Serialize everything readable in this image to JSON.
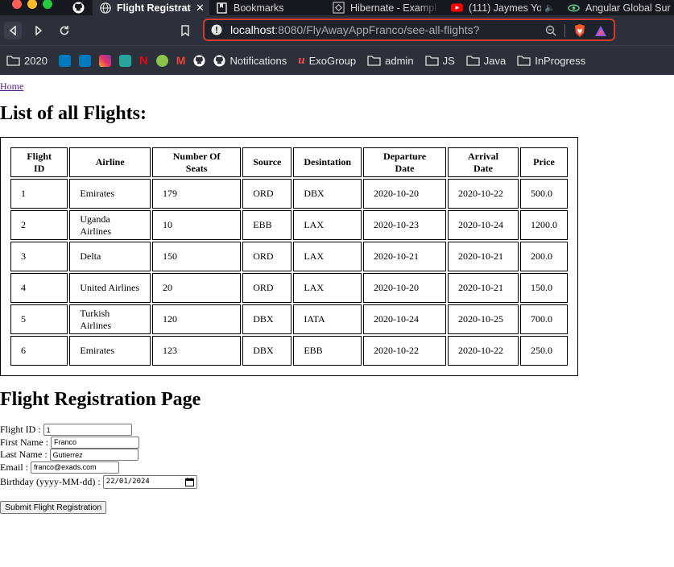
{
  "browser": {
    "tabs": [
      {
        "title": "Flight Registrat"
      },
      {
        "title": "Bookmarks"
      },
      {
        "title": "Hibernate - Exampl"
      },
      {
        "title": "(111) Jaymes Yo"
      },
      {
        "title": "Angular Global Sur"
      }
    ],
    "url": {
      "host": "localhost",
      "rest": ":8080/FlyAwayAppFranco/see-all-flights?"
    },
    "bookmarks": [
      {
        "label": "2020"
      },
      {
        "label": "Notifications"
      },
      {
        "label": "ExoGroup"
      },
      {
        "label": "admin"
      },
      {
        "label": "JS"
      },
      {
        "label": "Java"
      },
      {
        "label": "InProgress"
      }
    ]
  },
  "page": {
    "home_link": "Home",
    "list_title": "List of all Flights:",
    "table": {
      "headers": [
        "Flight ID",
        "Airline",
        "Number Of Seats",
        "Source",
        "Desintation",
        "Departure Date",
        "Arrival Date",
        "Price"
      ],
      "rows": [
        [
          "1",
          "Emirates",
          "179",
          "ORD",
          "DBX",
          "2020-10-20",
          "2020-10-22",
          "500.0"
        ],
        [
          "2",
          "Uganda Airlines",
          "10",
          "EBB",
          "LAX",
          "2020-10-23",
          "2020-10-24",
          "1200.0"
        ],
        [
          "3",
          "Delta",
          "150",
          "ORD",
          "LAX",
          "2020-10-21",
          "2020-10-21",
          "200.0"
        ],
        [
          "4",
          "United Airlines",
          "20",
          "ORD",
          "LAX",
          "2020-10-20",
          "2020-10-21",
          "150.0"
        ],
        [
          "5",
          "Turkish Airlines",
          "120",
          "DBX",
          "IATA",
          "2020-10-24",
          "2020-10-25",
          "700.0"
        ],
        [
          "6",
          "Emirates",
          "123",
          "DBX",
          "EBB",
          "2020-10-22",
          "2020-10-22",
          "250.0"
        ]
      ]
    },
    "registration_title": "Flight Registration Page",
    "form": {
      "flight_id_label": "Flight ID :",
      "flight_id_value": "1",
      "first_name_label": "First Name :",
      "first_name_value": "Franco",
      "last_name_label": "Last Name :",
      "last_name_value": "Gutierrez",
      "email_label": "Email :",
      "email_value": "franco@exads.com",
      "birthday_label": "Birthday (yyyy-MM-dd) :",
      "birthday_value": "22/01/2024",
      "submit_label": "Submit Flight Registration"
    }
  },
  "colors": {
    "url_border": "#d23b30",
    "chrome_bg": "#2b303b",
    "link": "#551a8b"
  }
}
